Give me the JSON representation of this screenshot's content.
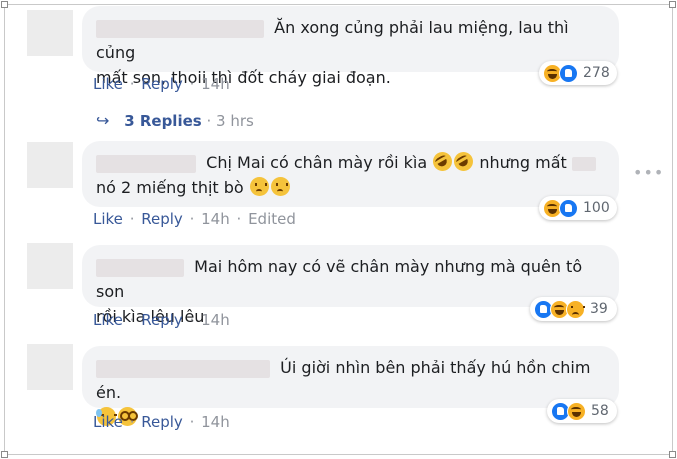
{
  "comments": [
    {
      "text": "Ăn xong củng phải lau miệng, lau thì củng mất son, thoii thì đốt cháy giai đoạn.",
      "like_label": "Like",
      "reply_label": "Reply",
      "time": "14h",
      "reaction_count": "278",
      "reactions": [
        "haha-reaction",
        "like-reaction"
      ]
    },
    {
      "text": "Chị Mai có chân mày rồi kìa 🤣🤣 nhưng mất nó 2 miếng thịt bò 😟😟",
      "like_label": "Like",
      "reply_label": "Reply",
      "time": "14h",
      "edited_label": "Edited",
      "reaction_count": "100",
      "reactions": [
        "haha-reaction",
        "like-reaction"
      ]
    },
    {
      "text": "Mai hôm nay có vẽ chân mày nhưng mà quên tô son rồi kìa lêu lêu",
      "like_label": "Like",
      "reply_label": "Reply",
      "time": "14h",
      "reaction_count": "39",
      "reactions": [
        "like-reaction",
        "haha-reaction",
        "sad-reaction"
      ]
    },
    {
      "text": "Úi giời nhìn bên phải thấy hú hồn chim én.",
      "like_label": "Like",
      "reply_label": "Reply",
      "time": "14h",
      "reaction_count": "58",
      "reactions": [
        "like-reaction",
        "haha-reaction"
      ]
    }
  ],
  "replies_link": {
    "label": "3 Replies",
    "time": "3 hrs",
    "icon": "reply-arrow-icon"
  },
  "c1": {
    "line1": "Ăn xong củng phải lau miệng, lau thì củng",
    "line2": "mất son, thoii thì đốt cháy giai đoạn."
  },
  "c2": {
    "line1_a": "Chị Mai có chân mày rồi kìa",
    "line1_b": "nhưng mất",
    "line2": "nó 2 miếng thịt bò"
  },
  "c3": {
    "line1": "Mai hôm nay có vẽ chân mày nhưng mà quên tô son",
    "line2": "rồi kìa lêu lêu"
  },
  "c4": {
    "line1": "Úi giời nhìn bên phải thấy hú hồn chim én."
  },
  "more_icon": "more-options-icon",
  "more_glyph": "•••",
  "sep": "·"
}
